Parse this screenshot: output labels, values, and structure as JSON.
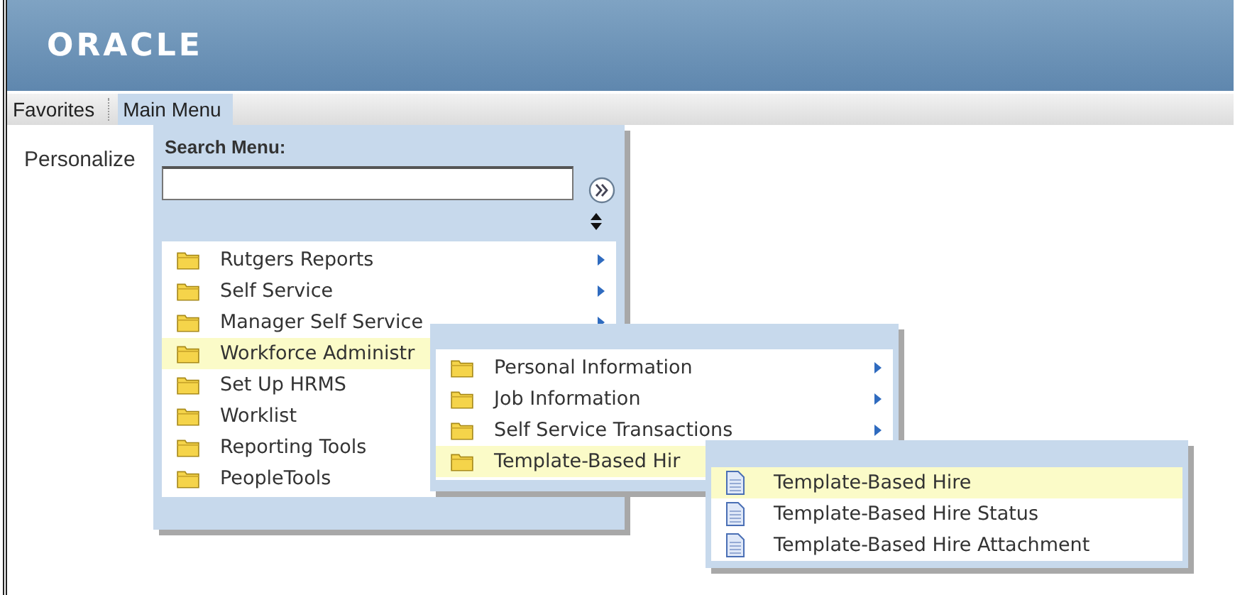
{
  "header": {
    "logo": "ORACLE"
  },
  "menubar": [
    {
      "label": "Favorites",
      "selected": false
    },
    {
      "label": "Main Menu",
      "selected": true
    }
  ],
  "page_label": "Personalize",
  "main_menu": {
    "title": "Search Menu:",
    "items": [
      {
        "label": "Rutgers Reports",
        "has_submenu": true,
        "selected": false
      },
      {
        "label": "Self Service",
        "has_submenu": true,
        "selected": false
      },
      {
        "label": "Manager Self Service",
        "has_submenu": true,
        "selected": false
      },
      {
        "label": "Workforce Administr",
        "selected": true
      },
      {
        "label": "Set Up HRMS",
        "selected": false
      },
      {
        "label": "Worklist",
        "selected": false
      },
      {
        "label": "Reporting Tools",
        "selected": false
      },
      {
        "label": "PeopleTools",
        "selected": false
      }
    ]
  },
  "submenu": {
    "items": [
      {
        "label": "Personal Information",
        "has_submenu": true,
        "selected": false
      },
      {
        "label": "Job Information",
        "has_submenu": true,
        "selected": false
      },
      {
        "label": "Self Service Transactions",
        "has_submenu": true,
        "selected": false
      },
      {
        "label": "Template-Based Hir",
        "selected": true
      }
    ]
  },
  "submenu_2": {
    "items": [
      {
        "label": "Template-Based Hire",
        "kind": "page",
        "selected": true
      },
      {
        "label": "Template-Based Hire Status",
        "kind": "page",
        "selected": false
      },
      {
        "label": "Template-Based Hire Attachment",
        "kind": "page",
        "selected": false
      }
    ]
  }
}
